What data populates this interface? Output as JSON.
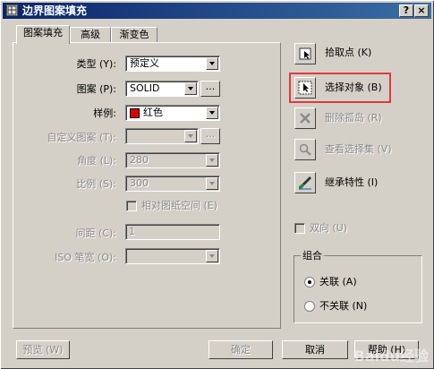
{
  "window": {
    "title": "边界图案填充",
    "help_button": "?",
    "close_button": "×"
  },
  "tabs": [
    {
      "label": "图案填充"
    },
    {
      "label": "高级"
    },
    {
      "label": "渐变色"
    }
  ],
  "hatch": {
    "type_label": "类型 (Y):",
    "type_value": "预定义",
    "pattern_label": "图案 (P):",
    "pattern_value": "SOLID",
    "pattern_browse": "...",
    "swatch_label": "样例:",
    "swatch_value": "红色",
    "swatch_color": "#e00000",
    "custom_pattern_label": "自定义图案 (T):",
    "custom_pattern_value": "",
    "custom_pattern_browse": "...",
    "angle_label": "角度 (L):",
    "angle_value": "280",
    "scale_label": "比例 (S):",
    "scale_value": "300",
    "relative_paper_label": "相对图纸空间 (E)",
    "spacing_label": "间距 (C):",
    "spacing_value": "1",
    "iso_label": "ISO 笔宽 (O):",
    "iso_value": ""
  },
  "actions": {
    "pick_points": "拾取点 (K)",
    "select_objects": "选择对象 (B)",
    "remove_islands": "删除孤岛 (R)",
    "view_selection": "查看选择集 (V)",
    "inherit_properties": "继承特性 (I)",
    "double": "双向 (U)"
  },
  "composition": {
    "title": "组合",
    "associative": "关联 (A)",
    "nonassociative": "不关联 (N)",
    "selected": "associative"
  },
  "footer": {
    "preview": "预览 (W)",
    "ok": "确定",
    "cancel": "取消",
    "help": "帮助 (H)"
  },
  "watermark": "Baidu经验"
}
